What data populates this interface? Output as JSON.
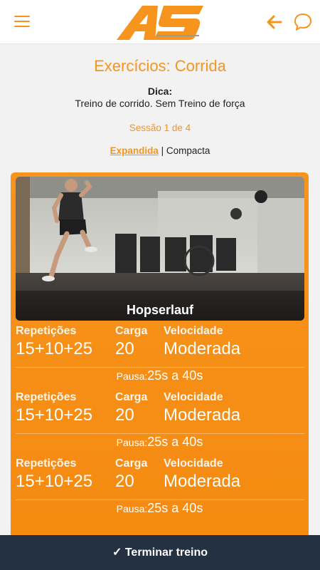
{
  "header": {
    "menu_icon": "hamburger-menu-icon",
    "logo_text": "AS",
    "back_icon": "arrow-left-icon",
    "chat_icon": "chat-bubble-icon",
    "accent_color": "#f7941d"
  },
  "page": {
    "title": "Exercícios: Corrida",
    "tip_label": "Dica:",
    "tip_text": "Treino de corrido. Sem Treino de força",
    "session": "Sessão 1 de 4",
    "view_active": "Expandida",
    "view_separator": "|",
    "view_other": "Compacta"
  },
  "exercise": {
    "name": "Hopserlauf",
    "sets": [
      {
        "reps_label": "Repetições",
        "reps": "15+10+25",
        "load_label": "Carga",
        "load": "20",
        "speed_label": "Velocidade",
        "speed": "Moderada",
        "pause_label": "Pausa:",
        "pause": "25s a 40s"
      },
      {
        "reps_label": "Repetições",
        "reps": "15+10+25",
        "load_label": "Carga",
        "load": "20",
        "speed_label": "Velocidade",
        "speed": "Moderada",
        "pause_label": "Pausa:",
        "pause": "25s a 40s"
      },
      {
        "reps_label": "Repetições",
        "reps": "15+10+25",
        "load_label": "Carga",
        "load": "20",
        "speed_label": "Velocidade",
        "speed": "Moderada",
        "pause_label": "Pausa:",
        "pause": "25s a 40s"
      }
    ]
  },
  "footer": {
    "finish_label": "✓ Terminar treino",
    "bg_color": "#243142"
  }
}
